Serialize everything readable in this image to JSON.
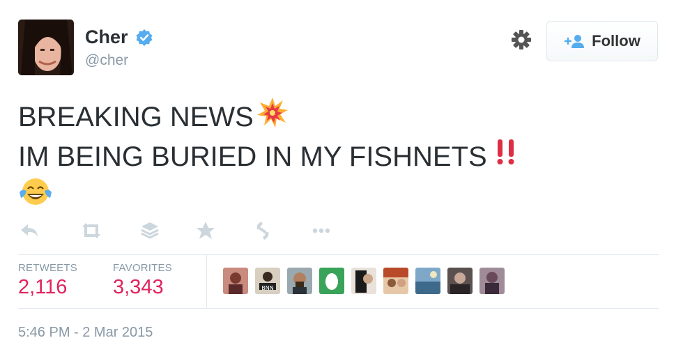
{
  "user": {
    "name": "Cher",
    "handle": "@cher",
    "verified_icon": "verified-badge-icon"
  },
  "header": {
    "gear_icon": "gear-icon",
    "follow_label": "Follow"
  },
  "tweet": {
    "line1": "BREAKING NEWS",
    "line2": "IM BEING BURIED IN MY FISHNETS",
    "line1_emoji": "collision-icon",
    "line2_emoji": "double-exclamation-icon",
    "line3_emoji": "tears-of-joy-icon"
  },
  "actions": [
    "reply-icon",
    "retweet-icon",
    "buffer-icon",
    "favorite-icon",
    "vine-icon",
    "more-icon"
  ],
  "stats": {
    "retweets_label": "RETWEETS",
    "retweets_value": "2,116",
    "favorites_label": "FAVORITES",
    "favorites_value": "3,343"
  },
  "favoriters_count_shown": 9,
  "timestamp": "5:46 PM - 2 Mar 2015",
  "colors": {
    "text": "#292f33",
    "muted": "#8899a6",
    "stat_value": "#e0245e",
    "verified": "#55acee",
    "border": "#e1e8ed",
    "icon_gray": "#ccd6dd"
  }
}
